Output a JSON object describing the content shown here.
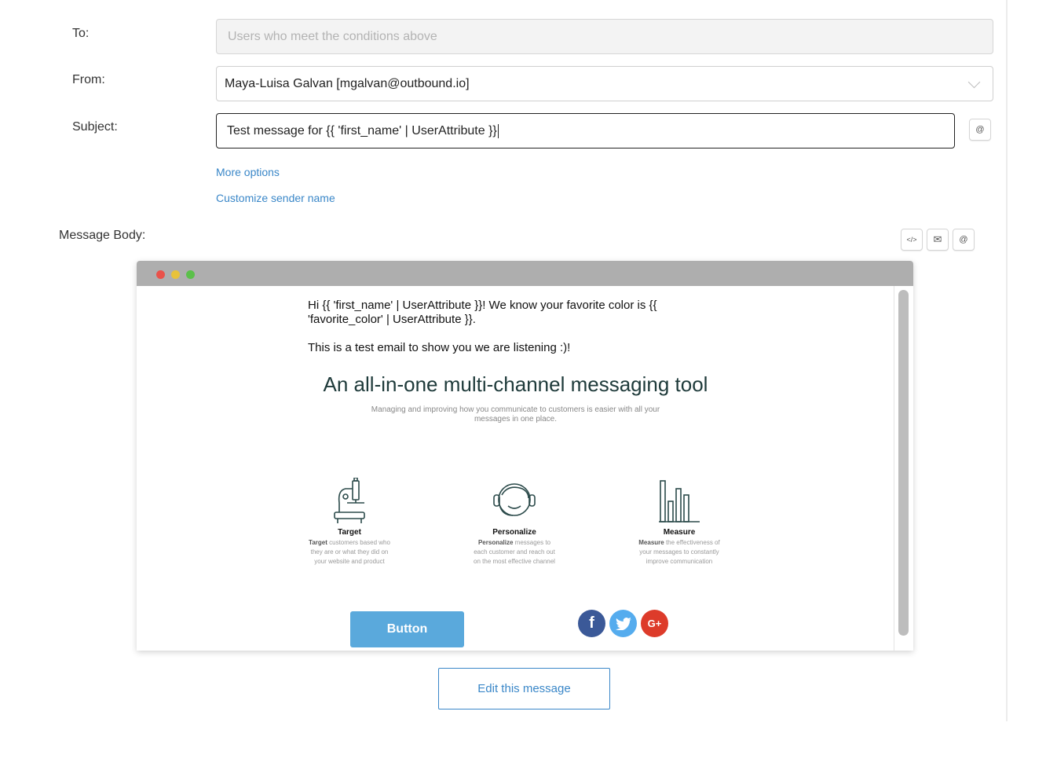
{
  "form": {
    "to_label": "To:",
    "to_placeholder": "Users who meet the conditions above",
    "from_label": "From:",
    "from_value": "Maya-Luisa Galvan [mgalvan@outbound.io]",
    "subject_label": "Subject:",
    "subject_value": "Test message for {{ 'first_name' | UserAttribute }}",
    "subject_mention_icon": "@",
    "more_options": "More options",
    "customize_sender": "Customize sender name",
    "body_label": "Message Body:"
  },
  "body_tools": {
    "code_icon": "</>",
    "mail_icon": "✉",
    "mention_icon": "@"
  },
  "preview": {
    "window_dots": [
      "#e9524a",
      "#e8c23a",
      "#5bc04a"
    ],
    "greeting_line1": "Hi {{ 'first_name' | UserAttribute }}! We know your favorite color is {{",
    "greeting_line2": "'favorite_color' | UserAttribute }}.",
    "test_line": "This is a test email to show you we are listening :)!",
    "hero_title": "An all-in-one multi-channel messaging tool",
    "hero_sub_line1": "Managing and improving how you communicate to customers is easier with all your",
    "hero_sub_line2": "messages in one place.",
    "features": [
      {
        "icon": "microscope-icon",
        "title": "Target",
        "lead": "Target",
        "desc1": " customers based who",
        "desc2": "they are or what they did on",
        "desc3": "your website and product"
      },
      {
        "icon": "headset-icon",
        "title": "Personalize",
        "lead": "Personalize",
        "desc1": " messages to",
        "desc2": "each customer and reach out",
        "desc3": "on the most effective channel"
      },
      {
        "icon": "bar-chart-icon",
        "title": "Measure",
        "lead": "Measure",
        "desc1": " the effectiveness of",
        "desc2": "your messages to constantly",
        "desc3": "improve communication"
      }
    ],
    "button_label": "Button",
    "social": [
      {
        "icon": "facebook-icon",
        "glyph": "f",
        "color": "#3b5998"
      },
      {
        "icon": "twitter-icon",
        "glyph": "🐦",
        "color": "#55acee"
      },
      {
        "icon": "google-plus-icon",
        "glyph": "G+",
        "color": "#dd3b2a"
      }
    ]
  },
  "edit_button": "Edit this message",
  "accent_color": "#3a87c8"
}
